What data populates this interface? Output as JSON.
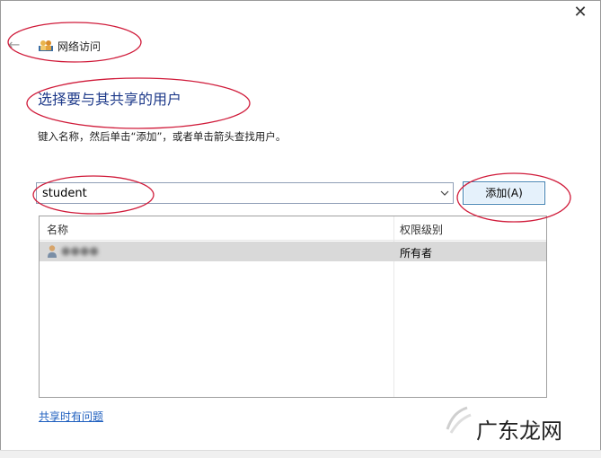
{
  "window": {
    "title": "网络访问",
    "close_glyph": "✕",
    "back_glyph": "←"
  },
  "main": {
    "heading": "选择要与其共享的用户",
    "instructions": "键入名称，然后单击“添加”，或者单击箭头查找用户。",
    "user_input": {
      "value": "student"
    },
    "add_button_label": "添加(A)"
  },
  "table": {
    "headers": [
      "名称",
      "权限级别"
    ],
    "rows": [
      {
        "name": "●●●●",
        "permission": "所有者"
      }
    ]
  },
  "footer": {
    "help_link": "共享时有问题"
  },
  "watermark": {
    "text": "广东龙网"
  },
  "colors": {
    "heading": "#1e3a8a",
    "link": "#1f5fbf",
    "annotation": "#d01b3a",
    "selected_row": "#d9d9d9"
  },
  "icons": {
    "back": "back-arrow-icon",
    "title": "network-users-icon",
    "dropdown": "chevron-down-icon",
    "user": "user-icon",
    "close": "close-icon"
  }
}
